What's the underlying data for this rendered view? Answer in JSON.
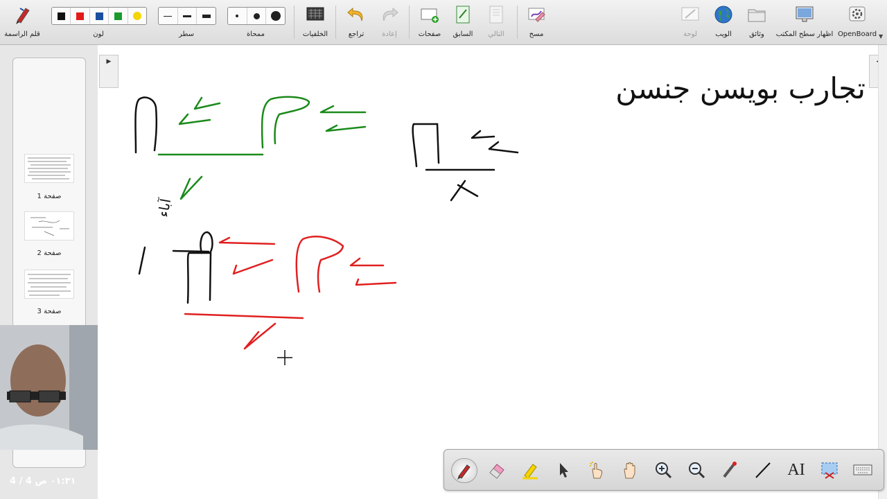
{
  "toolbar": {
    "pen_label": "قلم الراسمة",
    "color_label": "لون",
    "line_label": "سطر",
    "eraser_label": "ممحاة",
    "backgrounds_label": "الخلفيات",
    "undo_label": "تراجع",
    "redo_label": "إعادة",
    "pages_label": "صفحات",
    "previous_label": "السابق",
    "next_label": "التالي",
    "clear_label": "مسح",
    "board_label": "لوحة",
    "web_label": "الويب",
    "documents_label": "وثائق",
    "desktop_label": "اظهار سطح المكتب",
    "openboard_label": "OpenBoard",
    "colors": [
      "#111111",
      "#e31a1a",
      "#1a4fa0",
      "#1a9a2e",
      "#f5d400"
    ]
  },
  "thumbnails": [
    {
      "label": "صفحة 1"
    },
    {
      "label": "صفحة 2"
    },
    {
      "label": "صفحة 3"
    }
  ],
  "page_counter": "٠١:٣١ ص 4 / 4",
  "board": {
    "heading": "تجارب بويسن جنسن",
    "annotation": "آباء"
  },
  "ink_colors": {
    "green": "#1a8a1a",
    "red": "#e02020",
    "black": "#111111"
  },
  "palette": {
    "text_tool_label": "AI"
  }
}
